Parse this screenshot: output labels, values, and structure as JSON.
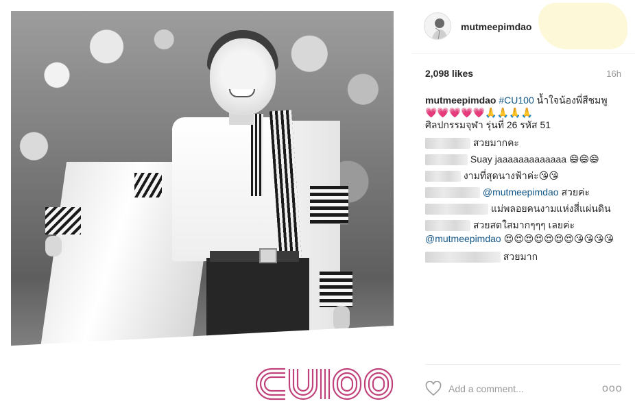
{
  "post": {
    "username": "mutmeepimdao",
    "likes": "2,098 likes",
    "time": "16h",
    "logo_text": "CU100"
  },
  "caption": {
    "username": "mutmeepimdao",
    "hashtag": "#CU100",
    "text1": " น้ำใจน้องพี่สีชมพู",
    "emoji": "💗💗💗💗💗🙏🙏🙏🙏",
    "text2": "ศิลปกรรมจุฬา รุ่นที่ 26 รหัส 51"
  },
  "comments": [
    {
      "text": "สวยมากคะ"
    },
    {
      "text": "Suay jaaaaaaaaaaaaa 😄😄😄"
    },
    {
      "text": "งามที่สุดนางฟ้าค่ะ😘😘"
    },
    {
      "mention": "@mutmeepimdao",
      "text": " สวยค่ะ"
    },
    {
      "text": "แม่พลอยคนงามแห่งสี่แผ่นดิน"
    },
    {
      "text": "สวยสดใสมากๆๆๆ เลยค่ะ",
      "mention2": "@mutmeepimdao",
      "text2": " 😍😍😍😍😍😍😍😘😘😘😘"
    },
    {
      "text": "สวยมาก"
    }
  ],
  "footer": {
    "placeholder": "Add a comment...",
    "more": "ooo"
  },
  "icons": {
    "heart": "heart-icon",
    "more": "more-options-icon",
    "avatar": "avatar"
  },
  "colors": {
    "link": "#125688",
    "logo": "#c0427a"
  }
}
